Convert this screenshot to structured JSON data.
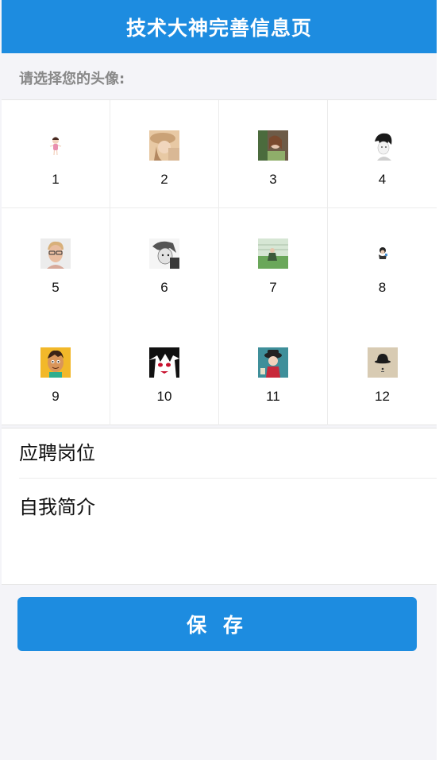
{
  "navbar": {
    "title": "技术大神完善信息页"
  },
  "avatar_section": {
    "title": "请选择您的头像:",
    "avatars": [
      {
        "label": "1",
        "icon": "avatar-cartoon-girl-icon"
      },
      {
        "label": "2",
        "icon": "avatar-girl-hat-icon"
      },
      {
        "label": "3",
        "icon": "avatar-girl-green-icon"
      },
      {
        "label": "4",
        "icon": "avatar-sketch-boy-icon"
      },
      {
        "label": "5",
        "icon": "avatar-man-glasses-icon"
      },
      {
        "label": "6",
        "icon": "avatar-manga-face-icon"
      },
      {
        "label": "7",
        "icon": "avatar-field-sitting-icon"
      },
      {
        "label": "8",
        "icon": "avatar-small-figure-icon"
      },
      {
        "label": "9",
        "icon": "avatar-cartoon-boy-icon"
      },
      {
        "label": "10",
        "icon": "avatar-anime-red-eyes-icon"
      },
      {
        "label": "11",
        "icon": "avatar-chibi-hat-icon"
      },
      {
        "label": "12",
        "icon": "avatar-bowler-hat-icon"
      }
    ]
  },
  "form": {
    "position_placeholder": "应聘岗位",
    "intro_placeholder": "自我简介"
  },
  "save_button": {
    "label": "保 存"
  },
  "colors": {
    "primary": "#1d8ce0",
    "background": "#f4f4f8"
  }
}
